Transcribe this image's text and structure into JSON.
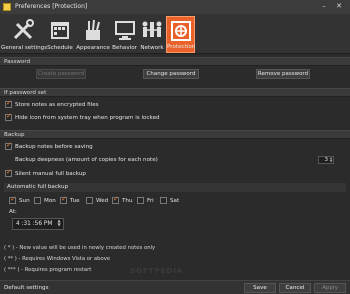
{
  "window": {
    "title": "Preferences [Protection]"
  },
  "toolbar": [
    {
      "label": "General settings",
      "icon": "wrench-screwdriver-icon"
    },
    {
      "label": "Schedule",
      "icon": "calendar-icon"
    },
    {
      "label": "Appearance",
      "icon": "brushes-icon"
    },
    {
      "label": "Behavior",
      "icon": "monitor-icon"
    },
    {
      "label": "Network",
      "icon": "network-people-icon"
    },
    {
      "label": "Protection",
      "icon": "safe-icon",
      "active": true
    }
  ],
  "password": {
    "header": "Password",
    "create_label": "Create password",
    "change_label": "Change password",
    "remove_label": "Remove password"
  },
  "if_password_set": {
    "header": "If password set",
    "store_encrypted": "Store notes as encrypted files",
    "hide_tray": "Hide icon from system tray when program is locked"
  },
  "backup": {
    "header": "Backup",
    "before_saving": "Backup notes before saving",
    "deepness_label": "Backup deepness (amount of copies for each note)",
    "deepness_value": "3",
    "silent_manual": "Silent manual full backup",
    "auto_header": "Automatic full backup",
    "days": [
      {
        "label": "Sun",
        "checked": true
      },
      {
        "label": "Mon",
        "checked": false
      },
      {
        "label": "Tue",
        "checked": true
      },
      {
        "label": "Wed",
        "checked": false
      },
      {
        "label": "Thu",
        "checked": true
      },
      {
        "label": "Fri",
        "checked": false
      },
      {
        "label": "Sat",
        "checked": false
      }
    ],
    "at_label": "At:",
    "time_value": "4 :31 :56  PM"
  },
  "notes": [
    "( * ) - New value will be used in newly created notes only",
    "( ** ) - Requires Windows Vista or above",
    "( *** ) - Requires program restart"
  ],
  "footer": {
    "default_settings": "Default settings",
    "save": "Save",
    "cancel": "Cancel",
    "apply": "Apply"
  },
  "watermark": "SOFTPEDIA",
  "colors": {
    "accent": "#e8622a",
    "background": "#2b2b2b",
    "check": "#f07a30"
  }
}
